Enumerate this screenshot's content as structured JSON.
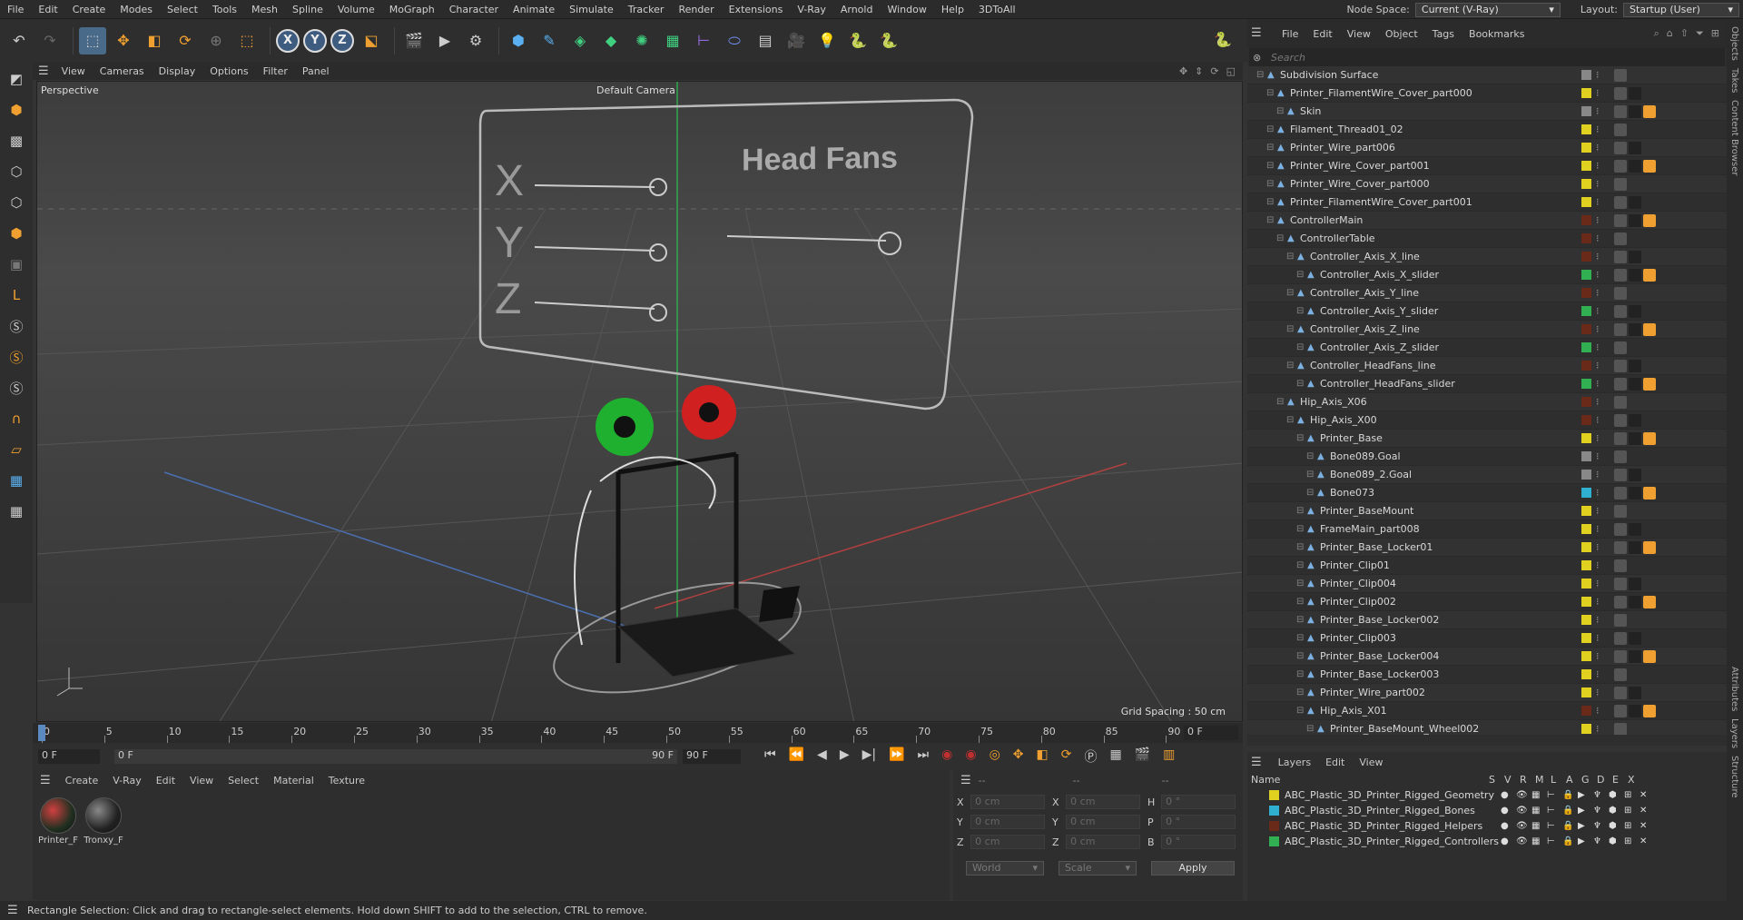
{
  "menubar": {
    "items": [
      "File",
      "Edit",
      "Create",
      "Modes",
      "Select",
      "Tools",
      "Mesh",
      "Spline",
      "Volume",
      "MoGraph",
      "Character",
      "Animate",
      "Simulate",
      "Tracker",
      "Render",
      "Extensions",
      "V-Ray",
      "Arnold",
      "Window",
      "Help",
      "3DToAll"
    ],
    "node_space_label": "Node Space:",
    "node_space_value": "Current (V-Ray)",
    "layout_label": "Layout:",
    "layout_value": "Startup (User)"
  },
  "viewport": {
    "menu": [
      "View",
      "Cameras",
      "Display",
      "Options",
      "Filter",
      "Panel"
    ],
    "view_name": "Perspective",
    "camera": "Default Camera",
    "grid_spacing": "Grid Spacing : 50 cm",
    "panel_title": "Head Fans",
    "axis_x": "X",
    "axis_y": "Y",
    "axis_z": "Z"
  },
  "timeline": {
    "ticks": [
      "0",
      "5",
      "10",
      "15",
      "20",
      "25",
      "30",
      "35",
      "40",
      "45",
      "50",
      "55",
      "60",
      "65",
      "70",
      "75",
      "80",
      "85",
      "90"
    ],
    "current_frame": "0 F",
    "start_frame": "0 F",
    "range_start": "0 F",
    "range_end": "90 F",
    "end_frame": "90 F"
  },
  "material": {
    "menu": [
      "Create",
      "V-Ray",
      "Edit",
      "View",
      "Select",
      "Material",
      "Texture"
    ],
    "items": [
      "Printer_F",
      "Tronxy_F"
    ]
  },
  "coords": {
    "header": [
      "--",
      "--",
      "--"
    ],
    "rows": [
      {
        "a": "X",
        "av": "0 cm",
        "b": "X",
        "bv": "0 cm",
        "c": "H",
        "cv": "0 °"
      },
      {
        "a": "Y",
        "av": "0 cm",
        "b": "Y",
        "bv": "0 cm",
        "c": "P",
        "cv": "0 °"
      },
      {
        "a": "Z",
        "av": "0 cm",
        "b": "Z",
        "bv": "0 cm",
        "c": "B",
        "cv": "0 °"
      }
    ],
    "world": "World",
    "scale": "Scale",
    "apply": "Apply"
  },
  "status": "Rectangle Selection: Click and drag to rectangle-select elements. Hold down SHIFT to add to the selection, CTRL to remove.",
  "objects": {
    "menu": [
      "File",
      "Edit",
      "View",
      "Object",
      "Tags",
      "Bookmarks"
    ],
    "search_placeholder": "Search",
    "rows": [
      {
        "name": "Subdivision Surface",
        "indent": 0,
        "color": "#888888"
      },
      {
        "name": "Printer_FilamentWire_Cover_part000",
        "indent": 1,
        "color": "#e0d020"
      },
      {
        "name": "Skin",
        "indent": 2,
        "color": "#888888"
      },
      {
        "name": "Filament_Thread01_02",
        "indent": 1,
        "color": "#e0d020"
      },
      {
        "name": "Printer_Wire_part006",
        "indent": 1,
        "color": "#e0d020"
      },
      {
        "name": "Printer_Wire_Cover_part001",
        "indent": 1,
        "color": "#e0d020"
      },
      {
        "name": "Printer_Wire_Cover_part000",
        "indent": 1,
        "color": "#e0d020"
      },
      {
        "name": "Printer_FilamentWire_Cover_part001",
        "indent": 1,
        "color": "#e0d020"
      },
      {
        "name": "ControllerMain",
        "indent": 1,
        "color": "#6a2a1a"
      },
      {
        "name": "ControllerTable",
        "indent": 2,
        "color": "#6a2a1a"
      },
      {
        "name": "Controller_Axis_X_line",
        "indent": 3,
        "color": "#6a2a1a"
      },
      {
        "name": "Controller_Axis_X_slider",
        "indent": 4,
        "color": "#30b050"
      },
      {
        "name": "Controller_Axis_Y_line",
        "indent": 3,
        "color": "#6a2a1a"
      },
      {
        "name": "Controller_Axis_Y_slider",
        "indent": 4,
        "color": "#30b050"
      },
      {
        "name": "Controller_Axis_Z_line",
        "indent": 3,
        "color": "#6a2a1a"
      },
      {
        "name": "Controller_Axis_Z_slider",
        "indent": 4,
        "color": "#30b050"
      },
      {
        "name": "Controller_HeadFans_line",
        "indent": 3,
        "color": "#6a2a1a"
      },
      {
        "name": "Controller_HeadFans_slider",
        "indent": 4,
        "color": "#30b050"
      },
      {
        "name": "Hip_Axis_X06",
        "indent": 2,
        "color": "#6a2a1a"
      },
      {
        "name": "Hip_Axis_X00",
        "indent": 3,
        "color": "#6a2a1a"
      },
      {
        "name": "Printer_Base",
        "indent": 4,
        "color": "#e0d020"
      },
      {
        "name": "Bone089.Goal",
        "indent": 5,
        "color": "#888888"
      },
      {
        "name": "Bone089_2.Goal",
        "indent": 5,
        "color": "#888888"
      },
      {
        "name": "Bone073",
        "indent": 5,
        "color": "#30b0d0"
      },
      {
        "name": "Printer_BaseMount",
        "indent": 4,
        "color": "#e0d020"
      },
      {
        "name": "FrameMain_part008",
        "indent": 4,
        "color": "#e0d020"
      },
      {
        "name": "Printer_Base_Locker01",
        "indent": 4,
        "color": "#e0d020"
      },
      {
        "name": "Printer_Clip01",
        "indent": 4,
        "color": "#e0d020"
      },
      {
        "name": "Printer_Clip004",
        "indent": 4,
        "color": "#e0d020"
      },
      {
        "name": "Printer_Clip002",
        "indent": 4,
        "color": "#e0d020"
      },
      {
        "name": "Printer_Base_Locker002",
        "indent": 4,
        "color": "#e0d020"
      },
      {
        "name": "Printer_Clip003",
        "indent": 4,
        "color": "#e0d020"
      },
      {
        "name": "Printer_Base_Locker004",
        "indent": 4,
        "color": "#e0d020"
      },
      {
        "name": "Printer_Base_Locker003",
        "indent": 4,
        "color": "#e0d020"
      },
      {
        "name": "Printer_Wire_part002",
        "indent": 4,
        "color": "#e0d020"
      },
      {
        "name": "Hip_Axis_X01",
        "indent": 4,
        "color": "#6a2a1a"
      },
      {
        "name": "Printer_BaseMount_Wheel002",
        "indent": 5,
        "color": "#e0d020"
      }
    ]
  },
  "layers": {
    "menu": [
      "Layers",
      "Edit",
      "View"
    ],
    "header_name": "Name",
    "header_cols": [
      "S",
      "V",
      "R",
      "M",
      "L",
      "A",
      "G",
      "D",
      "E",
      "X"
    ],
    "rows": [
      {
        "name": "ABC_Plastic_3D_Printer_Rigged_Geometry",
        "color": "#e0d020"
      },
      {
        "name": "ABC_Plastic_3D_Printer_Rigged_Bones",
        "color": "#30b0d0"
      },
      {
        "name": "ABC_Plastic_3D_Printer_Rigged_Helpers",
        "color": "#6a2a1a"
      },
      {
        "name": "ABC_Plastic_3D_Printer_Rigged_Controllers",
        "color": "#30b050"
      }
    ]
  },
  "right_tabs": [
    "Objects",
    "Takes",
    "Content Browser",
    "Attributes",
    "Layers",
    "Structure"
  ]
}
